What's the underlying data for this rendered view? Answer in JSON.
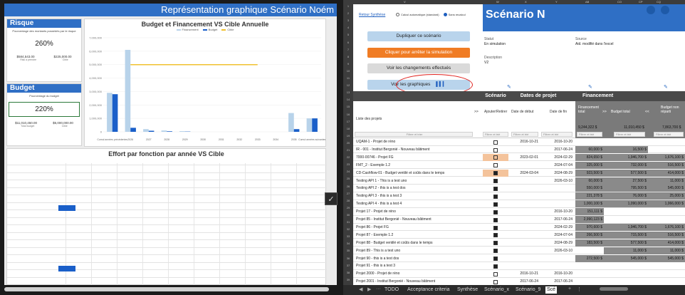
{
  "left": {
    "banner": "Représentation graphique Scénario Noém",
    "risk": {
      "title": "Risque",
      "subtitle": "Pourcentage des montants possédés par le risque",
      "percent": "260%",
      "val1": "$584,543.00",
      "val1_label": "Risk à prendre",
      "val2": "$225,000.00",
      "val2_label": "Cible"
    },
    "budget": {
      "title": "Budget",
      "subtitle": "Pourcentage du budget",
      "percent": "220%",
      "val1": "$11,010,450.00",
      "val1_label": "Total budget",
      "val2": "$5,000,000.00",
      "val2_label": "Cible"
    },
    "chart1": {
      "title": "Budget et Financement VS Cible Annuelle",
      "legend": [
        "Financement",
        "Budget",
        "Cible"
      ]
    },
    "chart2": {
      "title": "Effort par fonction par année VS Cible"
    }
  },
  "chart_data": [
    {
      "type": "bar",
      "title": "Budget et Financement VS Cible Annuelle",
      "categories": [
        "Cumul années précédentes",
        "2026",
        "2027",
        "2028",
        "2029",
        "2030",
        "2031",
        "2032",
        "2033",
        "2034",
        "2035",
        "Cumul années suivantes"
      ],
      "series": [
        {
          "name": "Financement",
          "values": [
            2900000,
            6100000,
            200000,
            100000,
            50000,
            0,
            0,
            0,
            0,
            0,
            1400000,
            1000000
          ]
        },
        {
          "name": "Budget",
          "values": [
            2800000,
            300000,
            80000,
            40000,
            20000,
            0,
            0,
            0,
            0,
            0,
            200000,
            1000000
          ]
        },
        {
          "name": "Cible",
          "values": [
            null,
            5000000,
            5000000,
            5000000,
            5000000,
            5000000,
            5000000,
            5000000,
            5000000,
            null,
            null,
            null
          ]
        }
      ],
      "ylim": [
        0,
        7000000
      ],
      "ytick_labels": [
        "0",
        "1,000,000",
        "2,000,000",
        "3,000,000",
        "4,000,000",
        "5,000,000",
        "6,000,000",
        "7,000,000"
      ],
      "legend_position": "top"
    },
    {
      "type": "bar",
      "title": "Effort par fonction par année VS Cible",
      "orientation": "horizontal"
    }
  ],
  "right": {
    "link": "Retour Synthèse",
    "radios": [
      "Calcul automatique (standard)",
      "Sans recalcul"
    ],
    "buttons": {
      "duplicate": "Dupliquer ce scénario",
      "stop": "Cliquer pour arrêter la simulation",
      "changes": "Voir les changements effectués",
      "charts": "Voir les graphiques"
    },
    "scenario_title": "Scénario N",
    "statut_label": "Statut",
    "statut_value": "En simulation",
    "source_label": "Source",
    "source_value": "Aid. modifié dans l'excel",
    "desc_label": "Description",
    "desc_value": "V2",
    "groups": [
      "Scénario",
      "Dates de projet",
      "Financement"
    ],
    "headers": {
      "projects": "Liste des projets",
      "add": "Ajouter/Retirer",
      "start": "Date de début",
      "end": "Date de fin",
      "funding": "Financement total",
      "budget": "Budget total",
      "unspent": "Budget non réparti",
      "funding_sum": "9,244,322 $",
      "budget_sum": "11,010,450 $",
      "unspent_sum": "7,863,700 $",
      "filter": "Filtrer et trier",
      "filter_short": "Filtrer et trié"
    },
    "rows": [
      {
        "name": "UQAM-1 - Projet de réno",
        "chk": false,
        "start": "2016-10-21",
        "end": "2016-10-20",
        "fin": "",
        "bud": "",
        "un": ""
      },
      {
        "name": "IR - 001 - Institut Bergonié - Nouveau bâtiment",
        "chk": false,
        "start": "",
        "end": "2017-06-24",
        "fin": "60,000 $",
        "bud": "16,500 $",
        "un": ""
      },
      {
        "name": "7000-00746 - Projet FG",
        "chk": false,
        "start": "2023-02-01",
        "end": "2024-02-29",
        "fin": "824,650 $",
        "bud": "1,946,700 $",
        "un": "1,676,100 $",
        "hl": true
      },
      {
        "name": "FMT_2 - Exemple 1.2",
        "chk": false,
        "start": "",
        "end": "2024-07-04",
        "fin": "325,000 $",
        "bud": "732,000 $",
        "un": "516,500 $"
      },
      {
        "name": "CD-Cashflow-01 - Budget ventilé et coûts dans le temps",
        "chk": true,
        "start": "2024-03-04",
        "end": "2024-08-29",
        "fin": "923,500 $",
        "bud": "577,500 $",
        "un": "414,000 $",
        "hl": true
      },
      {
        "name": "Testing API 1 - This is a test uno",
        "chk": true,
        "start": "",
        "end": "2026-03-10",
        "fin": "60,000 $",
        "bud": "27,500 $",
        "un": "11,000 $"
      },
      {
        "name": "Testing API 2 - this is a test dos",
        "chk": true,
        "start": "",
        "end": "",
        "fin": "550,000 $",
        "bud": "795,500 $",
        "un": "545,000 $"
      },
      {
        "name": "Testing API 3 - this is a test 3",
        "chk": true,
        "start": "",
        "end": "",
        "fin": "221,378 $",
        "bud": "76,000 $",
        "un": "25,000 $"
      },
      {
        "name": "Testing API 4 - this is a test 4",
        "chk": true,
        "start": "",
        "end": "",
        "fin": "1,000,100 $",
        "bud": "1,090,000 $",
        "un": "1,066,000 $"
      },
      {
        "name": "Projet 17 - Projet de réno",
        "chk": true,
        "start": "",
        "end": "2016-10-20",
        "fin": "151,111 $",
        "bud": "",
        "un": ""
      },
      {
        "name": "Projet 85 - Institut Bergonié - Nouveau bâtiment",
        "chk": true,
        "start": "",
        "end": "2017-06-24",
        "fin": "2,990,123 $",
        "bud": "",
        "un": ""
      },
      {
        "name": "Projet 86 - Projet FG",
        "chk": true,
        "start": "",
        "end": "2024-02-29",
        "fin": "970,600 $",
        "bud": "1,946,700 $",
        "un": "1,676,100 $"
      },
      {
        "name": "Projet 87 - Exemple 1.2",
        "chk": true,
        "start": "",
        "end": "2024-07-04",
        "fin": "266,500 $",
        "bud": "715,500 $",
        "un": "516,500 $"
      },
      {
        "name": "Projet 88 - Budget ventilé et coûts dans le temps",
        "chk": true,
        "start": "",
        "end": "2024-08-29",
        "fin": "183,500 $",
        "bud": "577,500 $",
        "un": "414,000 $"
      },
      {
        "name": "Projet 89 - This is a test uno",
        "chk": true,
        "start": "",
        "end": "2026-03-10",
        "fin": "",
        "bud": "11,000 $",
        "un": "11,000 $"
      },
      {
        "name": "Projet 90 - this is a test dos",
        "chk": true,
        "start": "",
        "end": "",
        "fin": "272,500 $",
        "bud": "545,000 $",
        "un": "545,000 $"
      },
      {
        "name": "Projet 91 - this is a test 3",
        "chk": true,
        "start": "",
        "end": "",
        "fin": "",
        "bud": "",
        "un": ""
      },
      {
        "name": "Projet 2000 - Projet de réno",
        "chk": false,
        "start": "2016-10-21",
        "end": "2016-10-20",
        "fin": "",
        "bud": "",
        "un": ""
      },
      {
        "name": "Projet 2001 - Institut Bergonié - Nouveau bâtiment",
        "chk": false,
        "start": "2017-06-24",
        "end": "2017-06-24",
        "fin": "",
        "bud": "",
        "un": ""
      }
    ],
    "tabs": [
      "TODO",
      "Acceptance criteria",
      "Synthèse",
      "Scénario_x",
      "Scénario_9",
      "Scé"
    ]
  }
}
